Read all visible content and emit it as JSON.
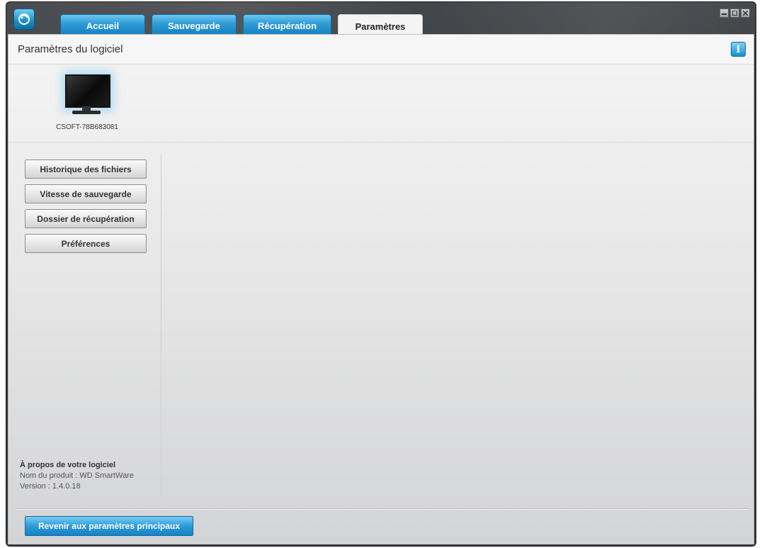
{
  "window": {
    "controls": [
      "minimize",
      "maximize",
      "close"
    ]
  },
  "tabs": [
    {
      "label": "Accueil",
      "active": false
    },
    {
      "label": "Sauvegarde",
      "active": false
    },
    {
      "label": "Récupération",
      "active": false
    },
    {
      "label": "Paramètres",
      "active": true
    }
  ],
  "header": {
    "title": "Paramètres du logiciel",
    "info_icon": "i"
  },
  "device": {
    "name": "CSOFT-78B683081",
    "icon": "monitor-icon"
  },
  "sidebar": {
    "items": [
      {
        "label": "Historique des fichiers"
      },
      {
        "label": "Vitesse de sauvegarde"
      },
      {
        "label": "Dossier de récupération"
      },
      {
        "label": "Préférences"
      }
    ]
  },
  "about": {
    "title": "À propos de votre logiciel",
    "product": "Nom du produit : WD SmartWare",
    "version": "Version : 1.4.0.18"
  },
  "footer": {
    "back_label": "Revenir aux paramètres principaux"
  },
  "colors": {
    "accent": "#1a8fd0",
    "chrome": "#2f3134"
  }
}
